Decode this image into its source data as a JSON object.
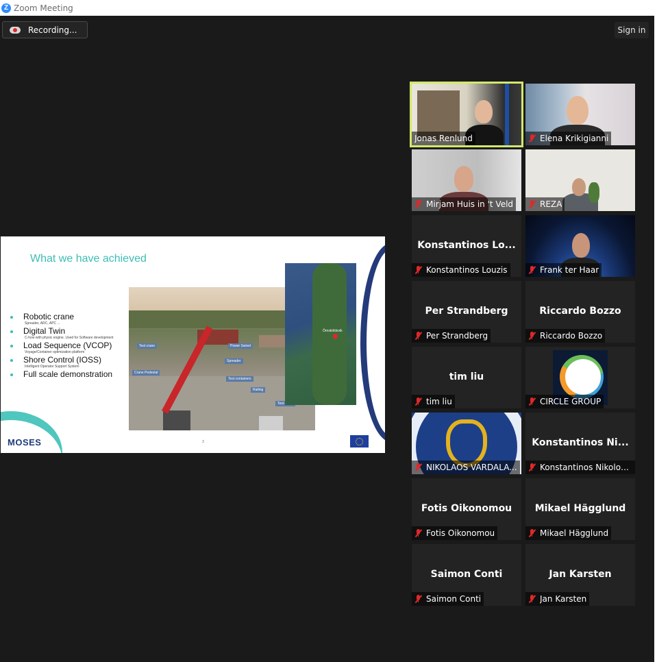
{
  "window": {
    "title": "Zoom Meeting",
    "app_icon": "zoom-logo-icon"
  },
  "toolbar": {
    "recording_label": "Recording...",
    "recording_icon": "cloud-record-icon",
    "signin_label": "Sign in"
  },
  "slide": {
    "title": "What we have achieved",
    "bullets": [
      {
        "main": "Robotic crane",
        "sub": "Spreader, ARC, APC ..."
      },
      {
        "main": "Digital Twin",
        "sub": "C-how with physic engine. Used for Software development"
      },
      {
        "main": "Load Sequence (VCOP)",
        "sub": "Voyage/Container optimization platform"
      },
      {
        "main": "Shore Control (IOSS)",
        "sub": "Intelligent Operator Support System"
      },
      {
        "main": "Full scale demonstration",
        "sub": ""
      }
    ],
    "photo_labels": [
      "Test crane",
      "Power Swivel",
      "Spreader",
      "Crane Pedestal",
      "Test containers",
      "Railing",
      "Test cabin"
    ],
    "map_label": "Örnsköldsvik",
    "logo_text": "MOSES",
    "page_number": "3"
  },
  "participants": [
    {
      "big": "",
      "caption": "Jonas Renlund",
      "muted": false,
      "active": true,
      "video": true
    },
    {
      "big": "",
      "caption": "Elena Krikigianni",
      "muted": true,
      "active": false,
      "video": true
    },
    {
      "big": "",
      "caption": "Mirjam Huis in 't Veld",
      "muted": true,
      "active": false,
      "video": true
    },
    {
      "big": "",
      "caption": "REZA",
      "muted": true,
      "active": false,
      "video": true
    },
    {
      "big": "Konstantinos  Lo...",
      "caption": "Konstantinos Louzis",
      "muted": true,
      "active": false,
      "video": false
    },
    {
      "big": "",
      "caption": "Frank ter Haar",
      "muted": true,
      "active": false,
      "video": true
    },
    {
      "big": "Per Strandberg",
      "caption": "Per Strandberg",
      "muted": true,
      "active": false,
      "video": false
    },
    {
      "big": "Riccardo Bozzo",
      "caption": "Riccardo Bozzo",
      "muted": true,
      "active": false,
      "video": false
    },
    {
      "big": "tim liu",
      "caption": "tim liu",
      "muted": true,
      "active": false,
      "video": false
    },
    {
      "big": "",
      "caption": "CIRCLE GROUP",
      "muted": true,
      "active": false,
      "video": true
    },
    {
      "big": "",
      "caption": "NIKOLAOS VARDALA...",
      "muted": true,
      "active": false,
      "video": true
    },
    {
      "big": "Konstantinos  Ni...",
      "caption": "Konstantinos Nikolop...",
      "muted": true,
      "active": false,
      "video": false
    },
    {
      "big": "Fotis Oikonomou",
      "caption": "Fotis Oikonomou",
      "muted": true,
      "active": false,
      "video": false
    },
    {
      "big": "Mikael Hägglund",
      "caption": "Mikael Hägglund",
      "muted": true,
      "active": false,
      "video": false
    },
    {
      "big": "Saimon Conti",
      "caption": "Saimon Conti",
      "muted": true,
      "active": false,
      "video": false
    },
    {
      "big": "Jan Karsten",
      "caption": "Jan Karsten",
      "muted": true,
      "active": false,
      "video": false
    }
  ],
  "colors": {
    "background": "#1a1a1a",
    "tile": "#232323",
    "active_speaker": "#d3e86c",
    "muted": "#e02828",
    "slide_accent": "#3dbdb5",
    "slide_navy": "#243a7a"
  }
}
